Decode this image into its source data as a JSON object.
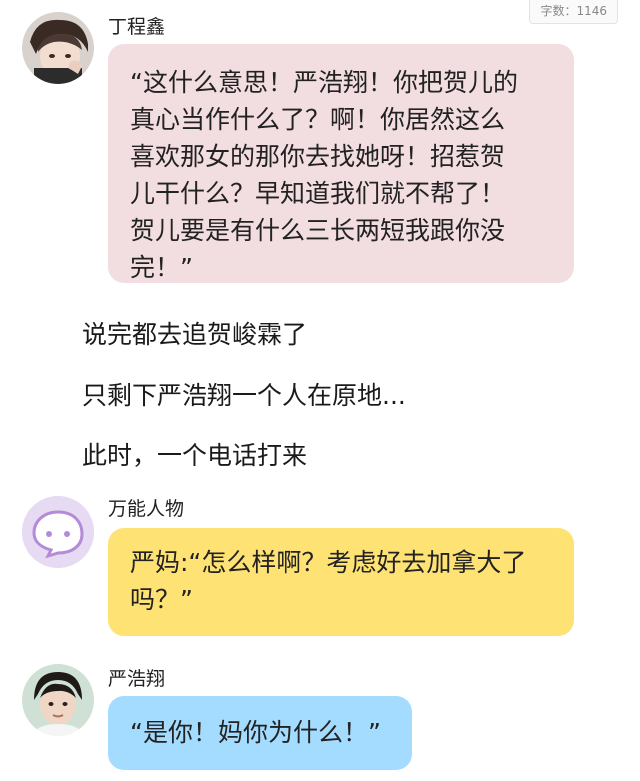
{
  "word_count": "字数：1146",
  "messages": [
    {
      "speaker": "丁程鑫",
      "text": "“这什么意思！严浩翔！你把贺儿的真心当作什么了？啊！你居然这么喜欢那女的那你去找她呀！招惹贺儿干什么？早知道我们就不帮了！贺儿要是有什么三长两短我跟你没完！”",
      "lines": [
        "“这什么意思！严浩翔！你把贺儿的",
        "真心当作什么了？啊！你居然这么",
        "喜欢那女的那你去找她呀！招惹贺",
        "儿干什么？早知道我们就不帮了！",
        "贺儿要是有什么三长两短我跟你没",
        "完！”"
      ],
      "bubble_color": "#f2dde0",
      "avatar_icon": "person-photo-icon"
    },
    {
      "speaker": "万能人物",
      "lines": [
        "严妈:“怎么样啊？考虑好去加拿大了",
        "吗？”"
      ],
      "bubble_color": "#ffe274",
      "avatar_icon": "chat-bubble-icon"
    },
    {
      "speaker": "严浩翔",
      "lines": [
        "“是你！妈你为什么！”"
      ],
      "bubble_color": "#a4dcff",
      "avatar_icon": "person-photo-icon"
    }
  ],
  "narration": [
    "说完都去追贺峻霖了",
    "只剩下严浩翔一个人在原地...",
    "此时，一个电话打来"
  ]
}
